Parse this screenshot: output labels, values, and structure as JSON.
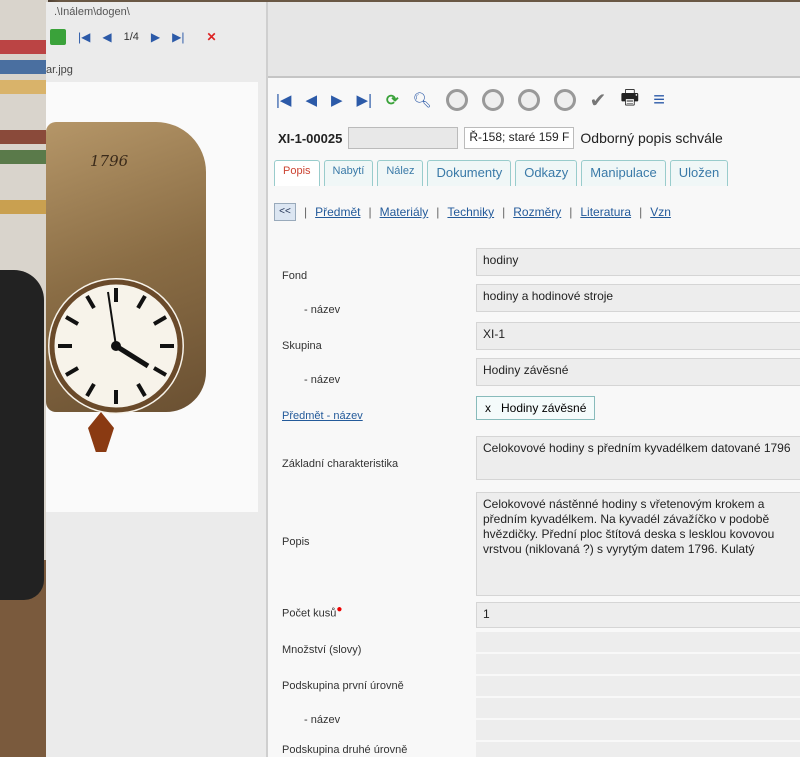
{
  "viewer": {
    "path": ".\\Inálem\\dogen\\",
    "count": "1/4",
    "file": "ar.jpg",
    "clock_year": "1796"
  },
  "toolbar": {
    "icons": [
      "first-icon",
      "prev-icon",
      "next-icon",
      "last-icon",
      "refresh-icon",
      "search-icon",
      "clock-icon",
      "circle-icon",
      "disc-icon",
      "minus-icon",
      "check-icon",
      "print-icon",
      "filter-icon"
    ]
  },
  "record": {
    "id": "XI-1-00025",
    "ref": "Ř-158; staré 159 F",
    "title": "Odborný popis schvále"
  },
  "tabs": [
    "Popis",
    "Nabytí",
    "Nález",
    "Dokumenty",
    "Odkazy",
    "Manipulace",
    "Uložen"
  ],
  "sublinks": {
    "back": "<<",
    "items": [
      "Předmět",
      "Materiály",
      "Techniky",
      "Rozměry",
      "Literatura",
      "Vzn"
    ]
  },
  "form": {
    "fond_label": "Fond",
    "fond_value": "hodiny",
    "fond_nazev_label": "- název",
    "fond_nazev_value": "hodiny a hodinové stroje",
    "skupina_label": "Skupina",
    "skupina_value": "XI-1",
    "skupina_nazev_label": "- název",
    "skupina_nazev_value": "Hodiny závěsné",
    "predmet_label": "Předmět - název",
    "predmet_tag_x": "x",
    "predmet_tag": "Hodiny závěsné",
    "zakladni_label": "Základní charakteristika",
    "zakladni_value": "Celokovové hodiny s předním kyvadélkem datované 1796",
    "popis_label": "Popis",
    "popis_value": "Celokovové nástěnné hodiny s vřetenovým krokem a předním kyvadélkem. Na kyvadél závažíčko v podobě hvězdičky. Přední ploc štítová deska s lesklou kovovou vrstvou (niklovaná ?) s vyrytým datem 1796. Kulatý",
    "pocet_label": "Počet kusů",
    "pocet_req": "●",
    "pocet_value": "1",
    "mnozstvi_label": "Množství (slovy)",
    "podskupina1_label": "Podskupina první úrovně",
    "podskupina1_nazev_label": "- název",
    "podskupina2_label": "Podskupina druhé úrovně"
  },
  "colors": {
    "accent_blue": "#2c5aa8",
    "tab_active_red": "#cc4433",
    "close_red": "#dd2222",
    "refresh_green": "#3aa23a"
  }
}
